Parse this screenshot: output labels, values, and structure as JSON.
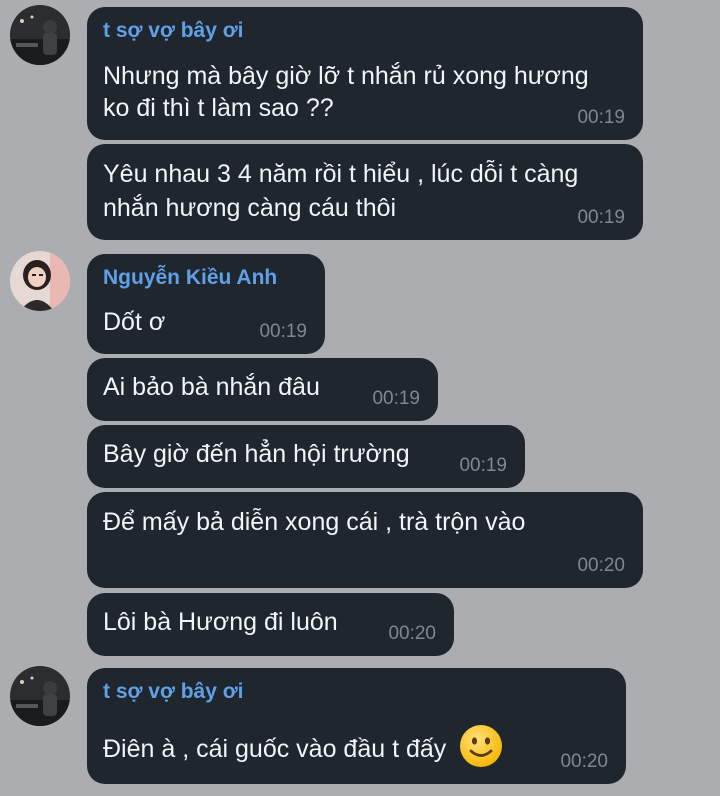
{
  "messages": [
    {
      "sender": "t sợ vợ bây ơi",
      "lines": [
        "Nhưng mà bây giờ lỡ t nhắn rủ xong hương",
        "ko đi thì t làm sao ??"
      ],
      "time": "00:19"
    },
    {
      "lines": [
        "Yêu nhau 3 4 năm rồi t hiểu , lúc dỗi t càng",
        "nhắn hương càng cáu thôi"
      ],
      "time": "00:19"
    },
    {
      "sender": "Nguyễn Kiều Anh",
      "lines": [
        "Dốt ơ"
      ],
      "time": "00:19"
    },
    {
      "lines": [
        "Ai bảo bà nhắn đâu"
      ],
      "time": "00:19"
    },
    {
      "lines": [
        "Bây giờ đến hẳn hội trường"
      ],
      "time": "00:19"
    },
    {
      "lines": [
        "Để mấy bả diễn xong cái , trà trộn vào"
      ],
      "time": "00:20"
    },
    {
      "lines": [
        "Lôi bà Hương đi luôn"
      ],
      "time": "00:20"
    },
    {
      "sender": "t sợ vợ bây ơi",
      "lines": [
        "Điên à , cái guốc vào đầu t đấy"
      ],
      "emoji": "slightly-smiling-face-icon",
      "time": "00:20"
    }
  ],
  "colors": {
    "background": "#acadb0",
    "bubble": "#1f262e",
    "sender_name": "#5fa0e6",
    "message_text": "#f2f4f6",
    "timestamp": "#7d8894"
  }
}
